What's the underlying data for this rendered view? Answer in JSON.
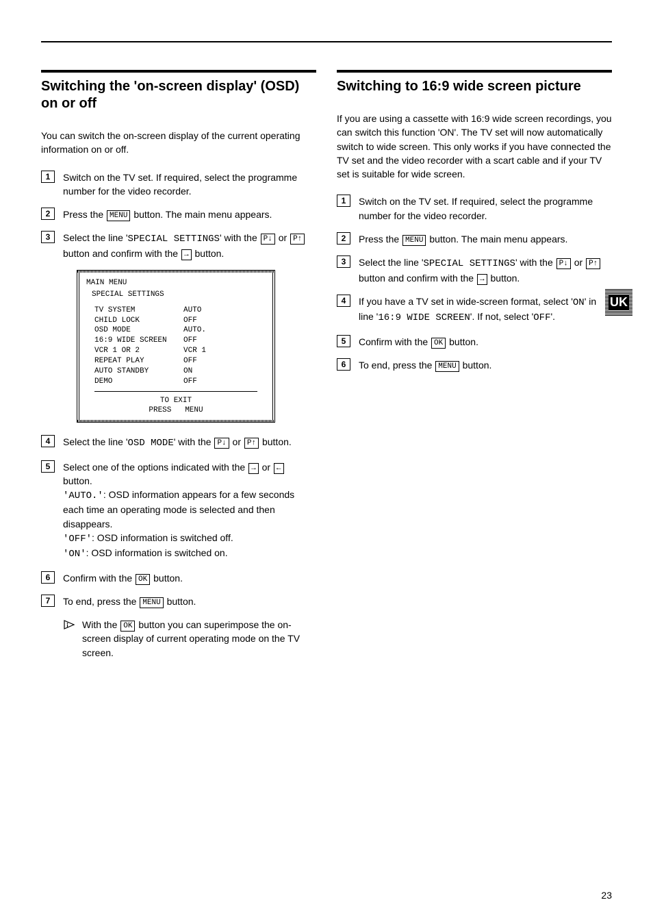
{
  "page_number": "23",
  "uk_tab": "UK",
  "buttons": {
    "menu": "MENU",
    "ok": "OK",
    "p_down": "P↓",
    "p_up": "P↑",
    "right": "→",
    "left": "←"
  },
  "left": {
    "title": "Switching the 'on-screen display' (OSD) on or off",
    "intro": "You can switch the on-screen display of the current operating information on or off.",
    "steps": {
      "s1": "Switch on the TV set. If required, select the programme number for the video recorder.",
      "s2a": "Press the ",
      "s2b": " button. The main menu appears.",
      "s3a": "Select the line '",
      "s3_sp": "SPECIAL SETTINGS",
      "s3b": "' with the ",
      "s3c": " or ",
      "s3d": " button and confirm with the ",
      "s3e": " button.",
      "s4a": "Select the line '",
      "s4_osd": "OSD MODE",
      "s4b": "' with the ",
      "s4c": " or ",
      "s4d": " button.",
      "s5a": "Select one of the options indicated with the ",
      "s5b": " or ",
      "s5c": " button.",
      "s5_auto_lbl": "'AUTO.'",
      "s5_auto_txt": ": OSD information appears for a few seconds each time an operating mode is selected and then disappears.",
      "s5_off_lbl": "'OFF'",
      "s5_off_txt": ": OSD information is switched off.",
      "s5_on_lbl": "'ON'",
      "s5_on_txt": ": OSD information is switched on.",
      "s6a": "Confirm with the ",
      "s6b": " button.",
      "s7a": "To end, press the ",
      "s7b": " button.",
      "hint_a": "With the ",
      "hint_b": " button you can superimpose the on-screen display of current operating mode on the TV screen."
    },
    "osd": {
      "title": "MAIN MENU",
      "sub": "SPECIAL SETTINGS",
      "rows": [
        {
          "l": "TV SYSTEM",
          "v": "AUTO"
        },
        {
          "l": "CHILD LOCK",
          "v": "OFF"
        },
        {
          "l": "OSD MODE",
          "v": "AUTO."
        },
        {
          "l": "16:9 WIDE SCREEN",
          "v": "OFF"
        },
        {
          "l": "VCR 1 OR 2",
          "v": "VCR 1"
        },
        {
          "l": "REPEAT PLAY",
          "v": "OFF"
        },
        {
          "l": "AUTO STANDBY",
          "v": "ON"
        },
        {
          "l": "DEMO",
          "v": "OFF"
        }
      ],
      "footer1": "TO EXIT",
      "footer2_a": "PRESS",
      "footer2_b": "MENU"
    }
  },
  "right": {
    "title": "Switching to 16:9 wide screen picture",
    "intro": "If you are using a cassette with 16:9 wide screen recordings, you can switch this function 'ON'. The TV set will now automatically switch to wide screen. This only works if you have connected the TV set and the video recorder with a scart cable and if your TV set is suitable for wide screen.",
    "steps": {
      "s1": "Switch on the TV set. If required, select the programme number for the video recorder.",
      "s2a": "Press the ",
      "s2b": " button. The main menu appears.",
      "s3a": "Select the line '",
      "s3_sp": "SPECIAL SETTINGS",
      "s3b": "' with the ",
      "s3c": " or ",
      "s3d": " button and confirm with the ",
      "s3e": " button.",
      "s4a": "If you have a TV set in wide-screen format, select '",
      "s4_on": "ON",
      "s4b": "' in line '",
      "s4_ws": "16:9 WIDE SCREEN",
      "s4c": "'. If not, select '",
      "s4_off": "OFF",
      "s4d": "'.",
      "s5a": "Confirm with the ",
      "s5b": " button.",
      "s6a": "To end, press the ",
      "s6b": " button."
    }
  }
}
